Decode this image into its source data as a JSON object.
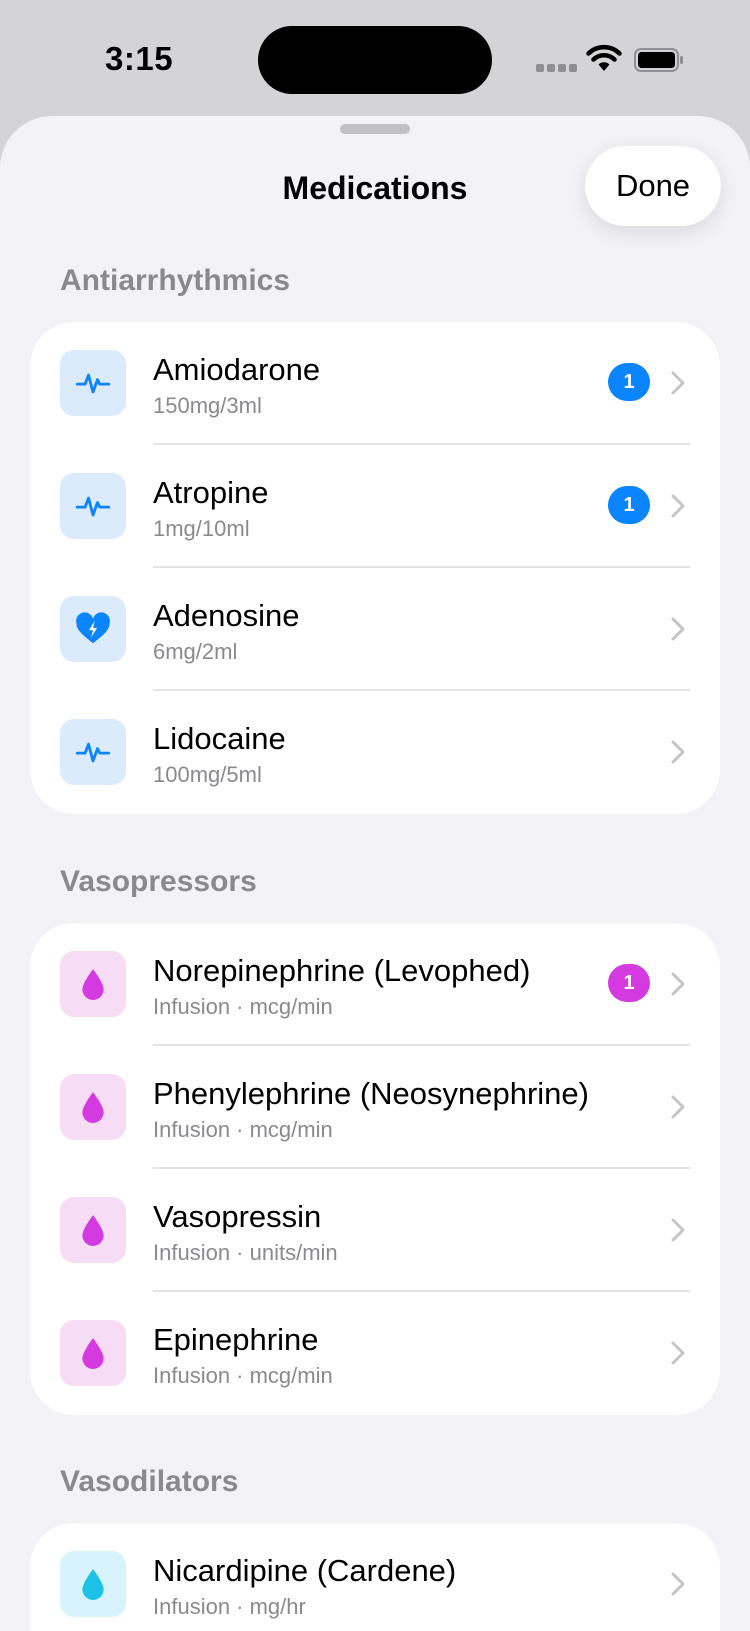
{
  "status_bar": {
    "time": "3:15"
  },
  "sheet": {
    "title": "Medications",
    "done_label": "Done"
  },
  "colors": {
    "blue": "#0a84ff",
    "magenta": "#d33ae0",
    "cyan": "#1cc3e6"
  },
  "sections": [
    {
      "header": "Antiarrhythmics",
      "items": [
        {
          "name": "Amiodarone",
          "detail": "150mg/3ml",
          "icon": "waveform-icon",
          "badge": "1"
        },
        {
          "name": "Atropine",
          "detail": "1mg/10ml",
          "icon": "waveform-icon",
          "badge": "1"
        },
        {
          "name": "Adenosine",
          "detail": "6mg/2ml",
          "icon": "heart-bolt-icon",
          "badge": null
        },
        {
          "name": "Lidocaine",
          "detail": "100mg/5ml",
          "icon": "waveform-icon",
          "badge": null
        }
      ]
    },
    {
      "header": "Vasopressors",
      "items": [
        {
          "name": "Norepinephrine (Levophed)",
          "detail": "Infusion · mcg/min",
          "icon": "drop-icon",
          "badge": "1"
        },
        {
          "name": "Phenylephrine (Neosynephrine)",
          "detail": "Infusion · mcg/min",
          "icon": "drop-icon",
          "badge": null
        },
        {
          "name": "Vasopressin",
          "detail": "Infusion · units/min",
          "icon": "drop-icon",
          "badge": null
        },
        {
          "name": "Epinephrine",
          "detail": "Infusion · mcg/min",
          "icon": "drop-icon",
          "badge": null
        }
      ]
    },
    {
      "header": "Vasodilators",
      "items": [
        {
          "name": "Nicardipine (Cardene)",
          "detail": "Infusion · mg/hr",
          "icon": "drop-icon",
          "badge": null
        }
      ]
    }
  ]
}
